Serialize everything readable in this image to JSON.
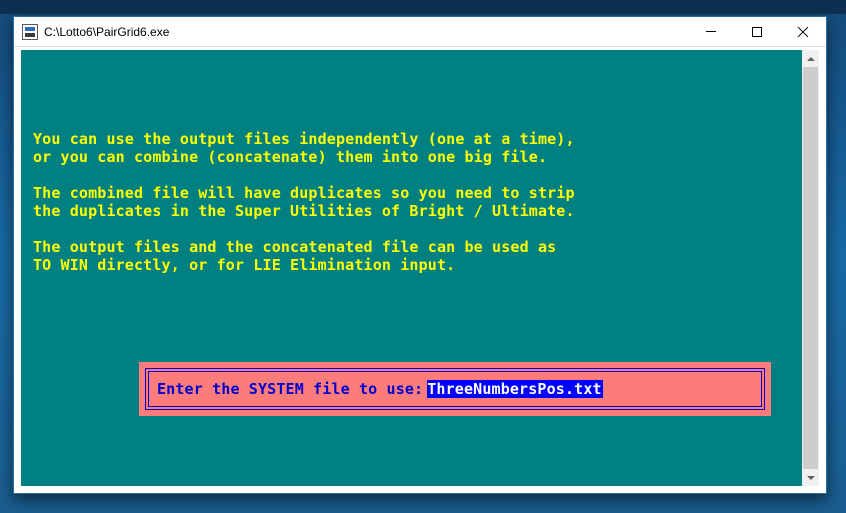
{
  "window": {
    "title": "C:\\Lotto6\\PairGrid6.exe"
  },
  "console": {
    "lines": [
      "You can use the output files independently (one at a time),",
      "or you can combine (concatenate) them into one big file.",
      "",
      "The combined file will have duplicates so you need to strip",
      "the duplicates in the Super Utilities of Bright / Ultimate.",
      "",
      "The output files and the concatenated file can be used as",
      "TO WIN directly, or for LIE Elimination input."
    ]
  },
  "prompt": {
    "label": "Enter the SYSTEM file to use: ",
    "value": "ThreeNumbersPos.txt"
  }
}
